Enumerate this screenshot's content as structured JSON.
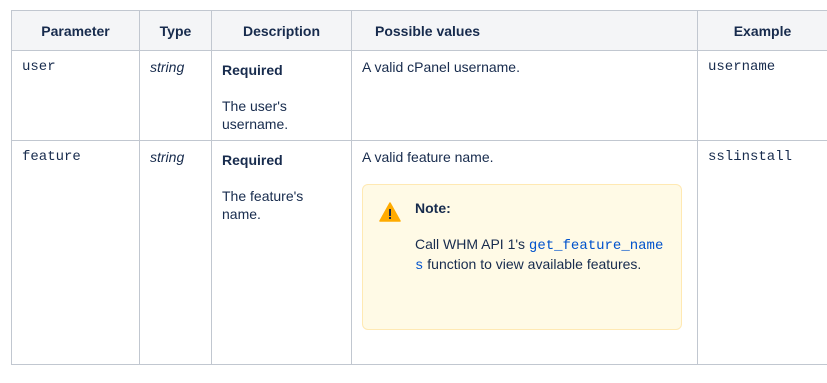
{
  "table": {
    "headers": [
      "Parameter",
      "Type",
      "Description",
      "Possible values",
      "Example"
    ],
    "rows": [
      {
        "parameter": "user",
        "type": "string",
        "required": "Required",
        "description": "The user's username.",
        "possible": "A valid cPanel username.",
        "example": "username"
      },
      {
        "parameter": "feature",
        "type": "string",
        "required": "Required",
        "description": "The feature's name.",
        "possible": "A valid feature name.",
        "example": "sslinstall",
        "note": {
          "title": "Note:",
          "text_before": "Call WHM API 1's ",
          "code": "get_feature_names",
          "text_after": " function to view available features.",
          "icon": "warning-icon",
          "bg_color": "#fffae6"
        }
      }
    ]
  }
}
